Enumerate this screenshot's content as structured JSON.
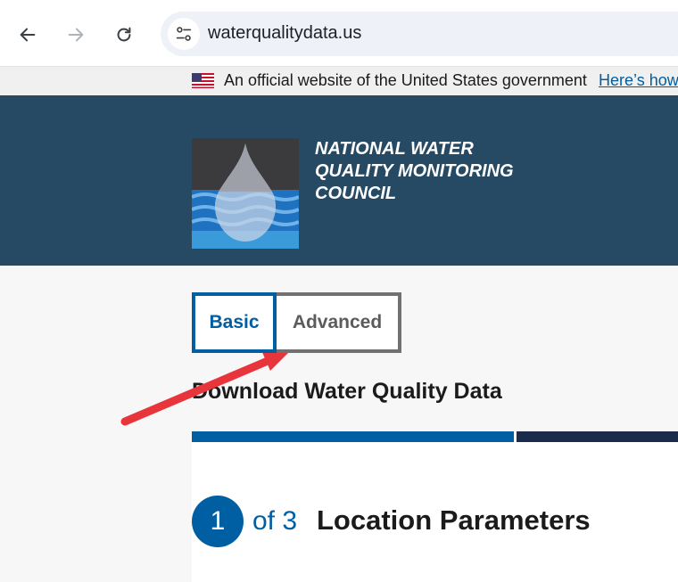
{
  "browser": {
    "url": "waterqualitydata.us",
    "back_icon": "back-arrow-icon",
    "forward_icon": "forward-arrow-icon",
    "reload_icon": "reload-icon",
    "site_info_icon": "tune-icon"
  },
  "gov_banner": {
    "text": "An official website of the United States government",
    "link": "Here’s how"
  },
  "header": {
    "org_name_lines": [
      "NATIONAL WATER",
      "QUALITY MONITORING",
      "COUNCIL"
    ]
  },
  "tabs": [
    {
      "label": "Basic",
      "active": true
    },
    {
      "label": "Advanced",
      "active": false
    }
  ],
  "page": {
    "title": "Download Water Quality Data",
    "step": {
      "number": "1",
      "of": "of 3",
      "title": "Location Parameters"
    }
  },
  "colors": {
    "header_bg": "#264a64",
    "primary": "#005ea2",
    "progress_dark": "#1a2b4c",
    "annotation_arrow": "#e8353b"
  }
}
